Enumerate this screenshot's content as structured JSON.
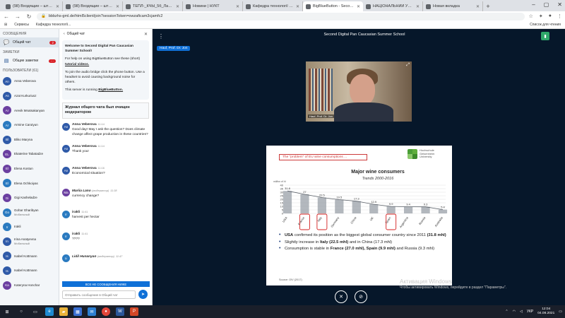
{
  "browser": {
    "tabs": [
      {
        "label": "(98) Входящие – штучний",
        "active": false
      },
      {
        "label": "(98) Входящие – штучний",
        "active": false
      },
      {
        "label": "ТЕПЛ-_КЧЫ_5б_Лабар",
        "active": false
      },
      {
        "label": "Новини | НУКТ",
        "active": false
      },
      {
        "label": "Кафедра технології рест",
        "active": false
      },
      {
        "label": "BigBlueButton - Second D",
        "active": true
      },
      {
        "label": "НАЦІОНАЛЬНИЙ УНІВЕР",
        "active": false
      },
      {
        "label": "Новая вкладка",
        "active": false
      }
    ],
    "url": "bbbzhs-gml.de/html5client/join?sessionToken=owzaficam3cjamfc2",
    "bookmarks": [
      "Сервисы",
      "Кафедра технології..."
    ],
    "bookmarks_right": "Список для чтения"
  },
  "sidebar": {
    "messages_title": "СООБЩЕНИЯ",
    "public_chat": {
      "label": "Общий чат",
      "badge": "2"
    },
    "notes_title": "ЗАМЕТКИ",
    "shared_notes": {
      "label": "Общие заметки",
      "badge": "···"
    },
    "users_title": "ПОЛЬЗОВАТЕЛИ (61)",
    "users": [
      {
        "initials": "An",
        "name": "Anna Veberova",
        "sub": "",
        "color": "#2f5aa8"
      },
      {
        "initials": "As",
        "name": "Azat Kurkuriusz",
        "sub": "",
        "color": "#2f5aa8"
      },
      {
        "initials": "Ar",
        "name": "Arevik Mnatsakanyan",
        "sub": "",
        "color": "#6b3fa0"
      },
      {
        "initials": "Ar",
        "name": "Armine Carutyun",
        "sub": "",
        "color": "#2a7ac0"
      },
      {
        "initials": "Bl",
        "name": "Bliko Maryna",
        "sub": "",
        "color": "#2f5aa8"
      },
      {
        "initials": "EL",
        "name": "Ekaterine Tabatadze",
        "sub": "",
        "color": "#6b3fa0"
      },
      {
        "initials": "El",
        "name": "Elena Kostun",
        "sub": "",
        "color": "#6b3fa0"
      },
      {
        "initials": "El",
        "name": "Elena Ochkoiyas",
        "sub": "",
        "color": "#2a7ac0"
      },
      {
        "initials": "Gi",
        "name": "Gigi Kasheladze",
        "sub": "",
        "color": "#6b3fa0"
      },
      {
        "initials": "Go",
        "name": "Gohar Gharibyan",
        "sub": "Мобильный",
        "color": "#2a7ac0"
      },
      {
        "initials": "Ir",
        "name": "Irakli",
        "sub": "",
        "color": "#2a7ac0"
      },
      {
        "initials": "In",
        "name": "Irina Anatyevna",
        "sub": "Мобильный",
        "color": "#2f5aa8"
      },
      {
        "initials": "Is",
        "name": "Isabel Kottmann",
        "sub": "",
        "color": "#2f5aa8"
      },
      {
        "initials": "Is",
        "name": "Isabel Kottmann",
        "sub": "",
        "color": "#2f5aa8"
      },
      {
        "initials": "Ka",
        "name": "Kateryna Honchar",
        "sub": "",
        "color": "#6b3fa0"
      }
    ]
  },
  "chat": {
    "back_label": "Общий чат",
    "welcome": {
      "title": "Welcome to Second Digital Pan Caucasian Summer School!",
      "help": "For help on using BigBlueButton see these (short) ",
      "help_link": "tutorial videos.",
      "audio": "To join the audio bridge click the phone button. Use a headset to avoid causing background noise for others.",
      "running": "This server is running ",
      "running_link": "BigBlueButton."
    },
    "moderator_note": "Журнал общего чата был очищен модератором",
    "messages": [
      {
        "initials": "An",
        "color": "#2f5aa8",
        "name": "Anna Veberova",
        "time": "11:14",
        "text": "Good day! May I ask the question? Does climate change affect grape production in these countries?"
      },
      {
        "initials": "An",
        "color": "#2f5aa8",
        "name": "Anna Veberova",
        "time": "11:14",
        "text": "Thank you!"
      },
      {
        "initials": "An",
        "color": "#2f5aa8",
        "name": "Anna Veberova",
        "time": "11:16",
        "text": "Economical situation?"
      },
      {
        "initials": "Ma",
        "color": "#6b3fa0",
        "name": "Mariia Lano",
        "role": "(модератор)",
        "time": "11:38",
        "text": "currency change?"
      },
      {
        "initials": "Ir",
        "color": "#2a7ac0",
        "name": "irakli",
        "time": "11:41",
        "text": "harvest per hectar"
      },
      {
        "initials": "Ir",
        "color": "#2a7ac0",
        "name": "irakli",
        "time": "11:41",
        "text": "????"
      },
      {
        "initials": "Li",
        "color": "#2a7ac0",
        "name": "Lidil Hunanyan",
        "role": "(модератор)",
        "time": "11:47",
        "text": ""
      }
    ],
    "new_messages_label": "ВСЕ НЕ СООБЩЕНИЯ НИЖЕ",
    "input_placeholder": "Отправить сообщение в Общий чат"
  },
  "main": {
    "title": "Second Digital Pan Caucasian Summer School",
    "presenter": "Hauf, Prof. Dr. Jon",
    "webcam_name": "Hauf, Prof. Dr. Jon",
    "slide": {
      "header": "The \"problem\" of EU wine consumptions ...",
      "logo_line1": "Hochschule",
      "logo_line2": "Geisenheim",
      "logo_line3": "University",
      "title": "Major wine consumers",
      "subtitle": "Trends 2000-2016",
      "bullets": [
        {
          "strong": "USA",
          "text": " confirmed its position as the biggest global consumer country since 2011 ",
          "strong2": "(31.8 mhl)",
          "rest": ""
        },
        {
          "strong": "",
          "text": "Slightly increase in ",
          "strong2": "Italy (22.5 mhl)",
          "rest": " and in China (17.3 mhl)"
        },
        {
          "strong": "",
          "text": "Consumption is stable in ",
          "strong2": "France (27.0 mhl), Spain (9.9 mhl)",
          "rest": " and Russia (9.3 mhl)"
        }
      ],
      "source": "Source: OIV (2017)"
    }
  },
  "chart_data": {
    "type": "area",
    "title": "Major wine consumers",
    "subtitle": "Trends 2000-2016",
    "ylabel": "million of hl",
    "ylim": [
      0,
      40
    ],
    "yticks": [
      0,
      5,
      10,
      15,
      20,
      25,
      30,
      35,
      40
    ],
    "categories": [
      "USA",
      "France",
      "Italy",
      "Germany",
      "China",
      "UK",
      "Spain",
      "Argentina",
      "Russia",
      "Australia"
    ],
    "values": [
      31.8,
      27.0,
      22.5,
      19.5,
      17.3,
      12.9,
      9.9,
      9.4,
      9.3,
      5.4
    ],
    "data_labels": [
      "31.8",
      "27",
      "22.5",
      "19.5",
      "17.3",
      "12.9",
      "9.9",
      "9.4",
      "9.3",
      "5.4"
    ],
    "circled": [
      "France",
      "Italy",
      "Spain"
    ]
  },
  "watermark": {
    "line1": "Активация Windows",
    "line2": "Чтобы активировать Windows, перейдите в раздел \"Параметры\"."
  },
  "taskbar": {
    "lang": "УКР",
    "time": "12:04",
    "date": "04.08.2021"
  }
}
